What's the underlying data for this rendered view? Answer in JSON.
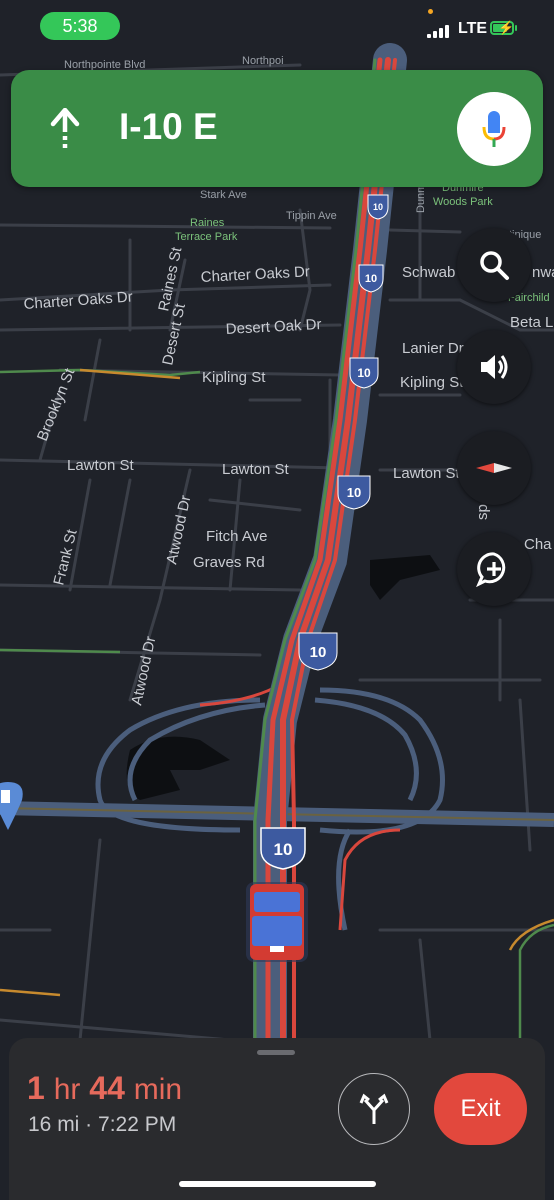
{
  "status_bar": {
    "time": "5:38",
    "network": "LTE"
  },
  "map": {
    "streets": {
      "northpointe": "Northpointe Blvd",
      "northpointe_short": "Northpoi",
      "stark": "Stark Ave",
      "tippin": "Tippin Ave",
      "raines_park_1": "Raines",
      "raines_park_2": "Terrace Park",
      "raines_st": "Raines St",
      "charter_oaks_left": "Charter Oaks Dr",
      "charter_oaks_mid": "Charter Oaks Dr",
      "desert_st": "Desert St",
      "desert_oak": "Desert Oak Dr",
      "brooklyn": "Brooklyn St",
      "kipling_left": "Kipling St",
      "kipling_right": "Kipling St",
      "lawton_left": "Lawton St",
      "lawton_mid": "Lawton St",
      "lawton_right": "Lawton St",
      "atwood_upper": "Atwood Dr",
      "atwood_lower": "Atwood Dr",
      "frank": "Frank St",
      "fitch": "Fitch Ave",
      "graves": "Graves Rd",
      "schwab": "Schwab D",
      "lanier": "Lanier Dr",
      "dunmire_1": "Dunmire",
      "dunmire_2": "Woods Park",
      "dunmire_st": "Dunm",
      "beta": "Beta Ln",
      "fairchild": "Fairchild",
      "cha": "Cha",
      "tinique": "tinique",
      "nwa": "nwa",
      "sp": "sp"
    },
    "route_shield": "10"
  },
  "banner": {
    "road": "I-10 E"
  },
  "buttons": {
    "search": "search",
    "sound": "sound",
    "compass": "compass",
    "report": "add report"
  },
  "trip": {
    "hours": "1",
    "hours_unit": "hr",
    "minutes": "44",
    "minutes_unit": "min",
    "summary": "16 mi · 7:22 PM",
    "exit_label": "Exit"
  },
  "colors": {
    "banner": "#3a8c47",
    "heavy_traffic": "#d9473d",
    "exit_button": "#e2483d",
    "eta_text": "#e66a5c"
  }
}
